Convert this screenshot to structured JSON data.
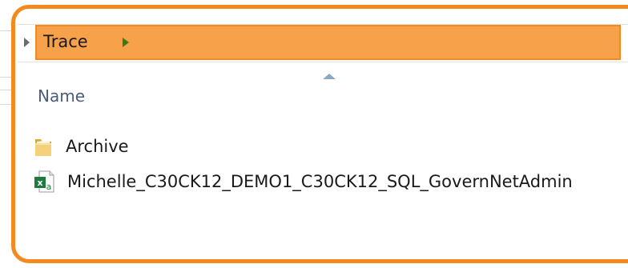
{
  "address_bar": {
    "current_folder": "Trace"
  },
  "file_list": {
    "column_header": "Name",
    "items": [
      {
        "name": "Archive",
        "icon": "folder-icon"
      },
      {
        "name": "Michelle_C30CK12_DEMO1_C30CK12_SQL_GovernNetAdmin",
        "icon": "excel-file-icon"
      }
    ]
  },
  "colors": {
    "highlight_fill": "#f7a14a",
    "highlight_border": "#f28a1e",
    "callout_border": "#f28a1e",
    "excel_green": "#1f7a3d",
    "folder_yellow": "#e9c46a"
  }
}
